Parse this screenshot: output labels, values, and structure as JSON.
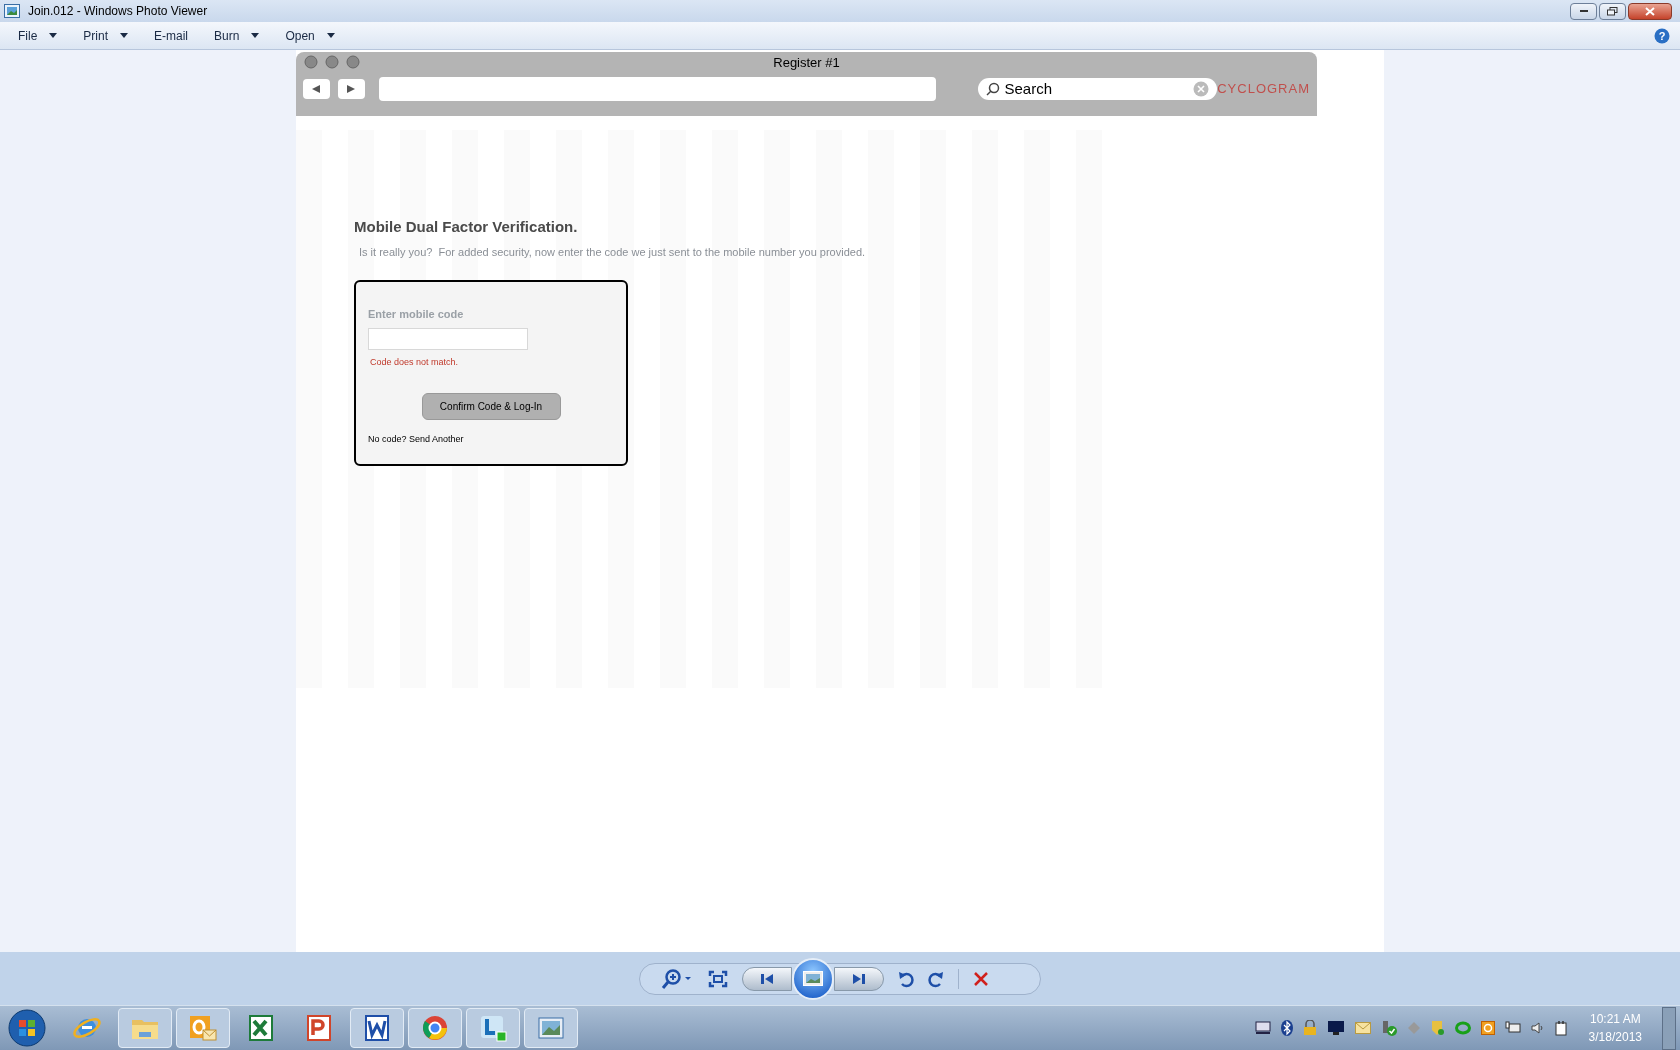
{
  "window": {
    "title": "Join.012 - Windows Photo Viewer"
  },
  "menu": [
    {
      "label": "File",
      "dropdown": true
    },
    {
      "label": "Print",
      "dropdown": true
    },
    {
      "label": "E-mail",
      "dropdown": false
    },
    {
      "label": "Burn",
      "dropdown": true
    },
    {
      "label": "Open",
      "dropdown": true
    }
  ],
  "help": "?",
  "mockup": {
    "title": "Register #1",
    "search_placeholder": "Search",
    "logo": "CYCLOGRAM"
  },
  "page": {
    "heading": "Mobile Dual Factor Verification.",
    "subheading": "Is it really you?  For added security, now enter the code we just sent to the mobile number you provided.",
    "form": {
      "label": "Enter mobile code",
      "error": "Code does not match.",
      "button": "Confirm Code & Log-In",
      "footer": "No code? Send Another"
    }
  },
  "taskbar": {
    "apps": [
      {
        "kind": "browser",
        "open": false
      },
      {
        "kind": "folder",
        "open": true
      },
      {
        "kind": "mail",
        "open": true
      },
      {
        "kind": "spreadsheet",
        "open": false
      },
      {
        "kind": "slides",
        "open": false
      },
      {
        "kind": "document",
        "open": true
      },
      {
        "kind": "globe",
        "open": true
      },
      {
        "kind": "chat",
        "open": true
      },
      {
        "kind": "photo",
        "open": true
      }
    ],
    "clock_time": "10:21 AM",
    "clock_date": "3/18/2013"
  }
}
